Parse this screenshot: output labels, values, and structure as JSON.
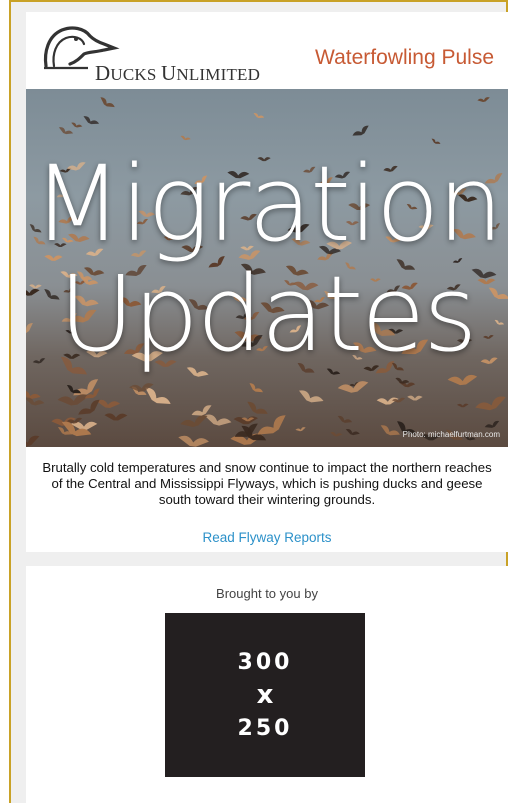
{
  "header": {
    "logo_text_first": "D",
    "logo_text_rest": "UCKS ",
    "logo_text_second": "U",
    "logo_text_rest2": "NLIMITED",
    "newsletter_title": "Waterfowling Pulse"
  },
  "hero": {
    "headline_line1": "Migration",
    "headline_line2": "Updates",
    "photo_credit": "Photo: michaelfurtman.com"
  },
  "content": {
    "intro_text": "Brutally cold temperatures and snow continue to impact the northern reaches of the Central and Mississippi Flyways, which is pushing ducks and geese south toward their wintering grounds.",
    "cta_label": "Read Flyway Reports"
  },
  "sponsor": {
    "label": "Brought to you by",
    "ad_line1": "300",
    "ad_line2": "x",
    "ad_line3": "250"
  },
  "colors": {
    "accent": "#c75a34",
    "link": "#2c91c9",
    "frame": "#c9a227",
    "ad_bg": "#231f20"
  },
  "icons": {
    "logo": "duck-head-logo-icon"
  }
}
